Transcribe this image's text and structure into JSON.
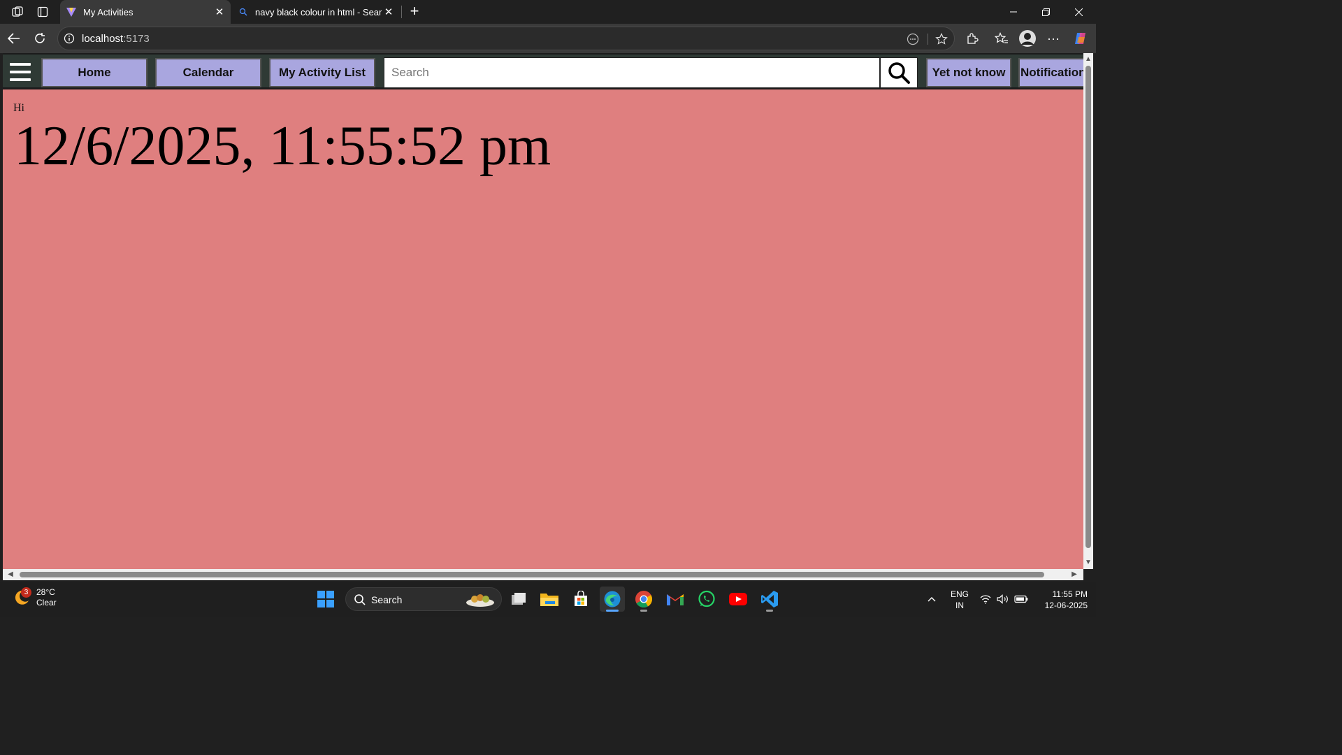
{
  "browser": {
    "tabs": [
      {
        "title": "My Activities",
        "active": true
      },
      {
        "title": "navy black colour in html - Search",
        "active": false
      }
    ],
    "address": {
      "host": "localhost",
      "port": ":5173"
    }
  },
  "app": {
    "nav_buttons": [
      "Home",
      "Calendar",
      "My Activity List"
    ],
    "search_placeholder": "Search",
    "right_buttons": [
      "Yet not know",
      "Notification"
    ],
    "greeting": "Hi",
    "datetime": "12/6/2025, 11:55:52 pm",
    "colors": {
      "background": "#df7f7f",
      "button": "#a9a6df",
      "navbar": "#2f3a35"
    }
  },
  "taskbar": {
    "weather": {
      "temp": "28°C",
      "condition": "Clear",
      "badge": "3"
    },
    "search_label": "Search",
    "lang": [
      "ENG",
      "IN"
    ],
    "time": "11:55 PM",
    "date": "12-06-2025"
  }
}
